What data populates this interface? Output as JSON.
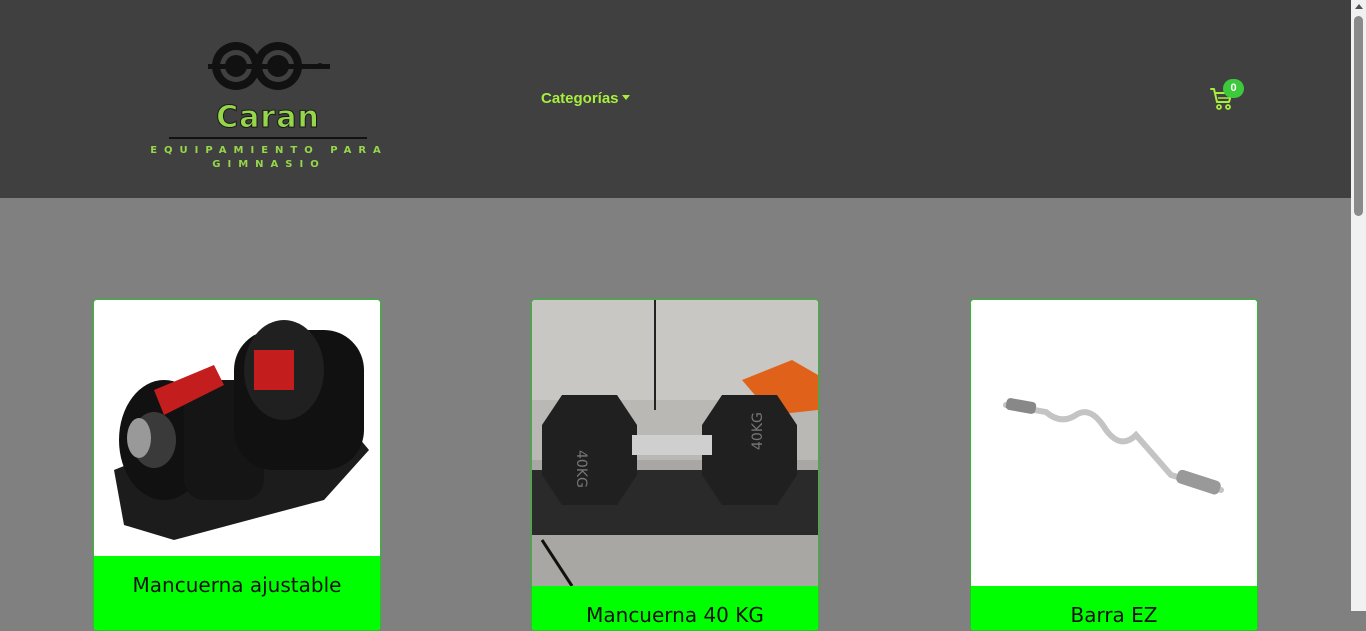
{
  "brand": {
    "name": "Caran",
    "tagline_line1": "Equipamiento para",
    "tagline_line2": "gimnasio",
    "accent": "#96d64a"
  },
  "nav": {
    "categories_label": "Categorías",
    "cart_icon": "cart-icon",
    "cart_count": "0"
  },
  "products": [
    {
      "title": "Mancuerna ajustable",
      "image": "adjustable-dumbbell-image"
    },
    {
      "title": "Mancuerna 40 KG",
      "image": "hex-dumbbell-40kg-image"
    },
    {
      "title": "Barra EZ",
      "image": "ez-curl-bar-image"
    }
  ],
  "colors": {
    "navbar": "#404040",
    "page_bg": "#808080",
    "card_footer": "#00ff00",
    "link": "#a7ef3f"
  }
}
